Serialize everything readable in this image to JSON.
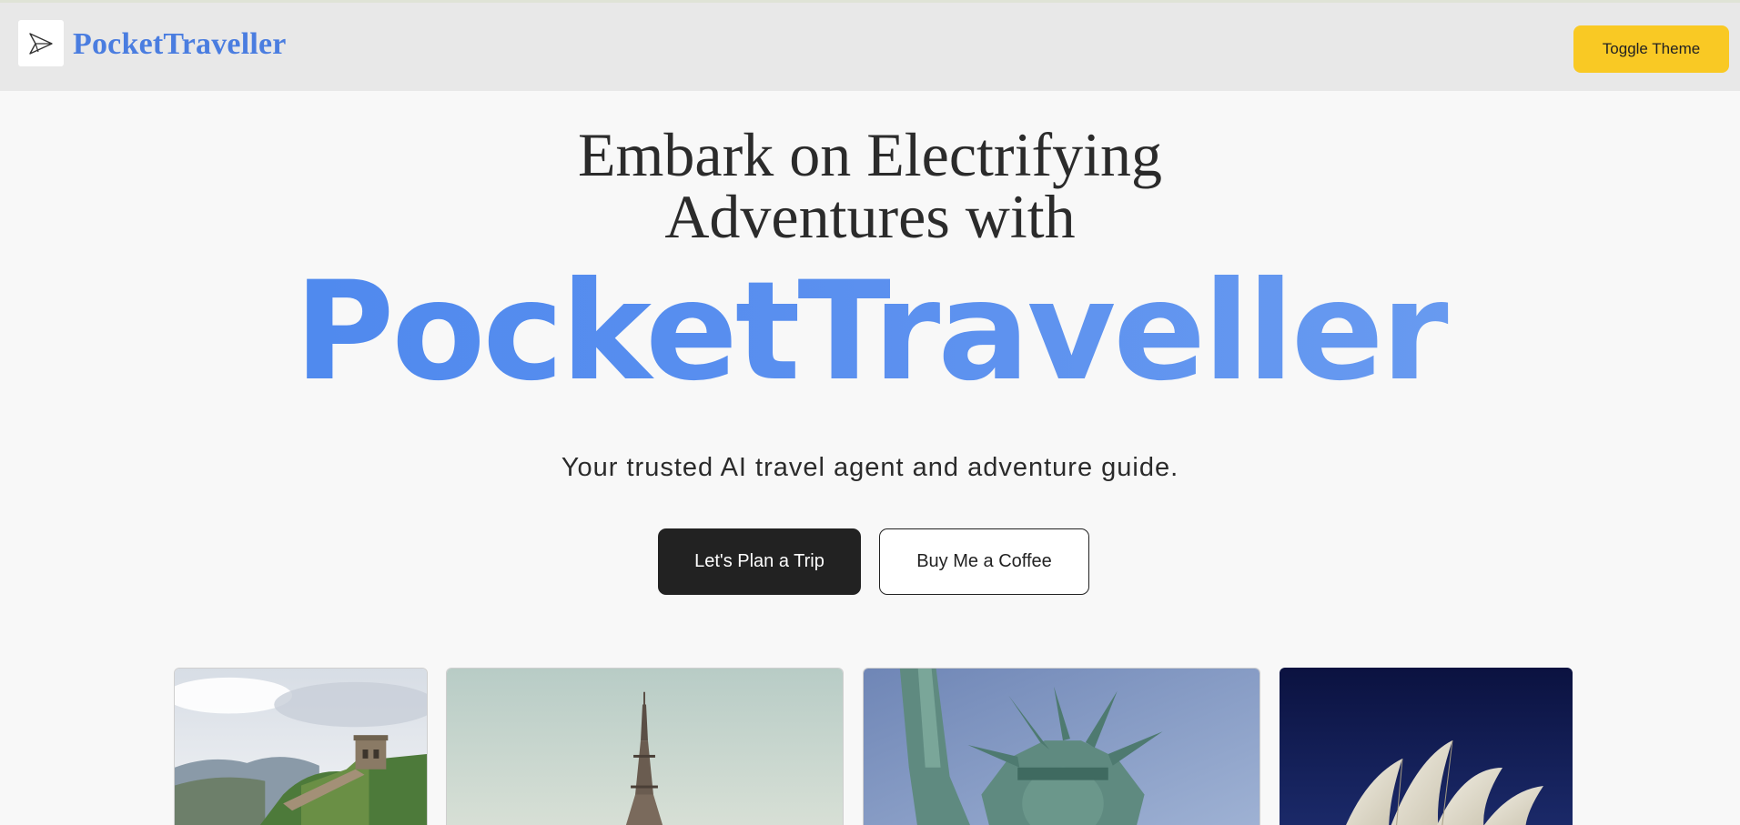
{
  "header": {
    "brand": "PocketTraveller",
    "logo_icon": "paper-plane-icon",
    "toggle_theme_label": "Toggle Theme"
  },
  "hero": {
    "line1": "Embark on Electrifying",
    "line2": "Adventures with",
    "brand": "PocketTraveller",
    "tagline": "Your trusted AI travel agent and adventure guide.",
    "primary_cta": "Let's Plan a Trip",
    "secondary_cta": "Buy Me a Coffee"
  },
  "colors": {
    "brand_blue": "#4a7de0",
    "toggle_yellow": "#f9c924",
    "primary_button": "#222222"
  },
  "gallery": [
    {
      "image": "great-wall-photo"
    },
    {
      "image": "eiffel-tower-photo"
    },
    {
      "image": "statue-of-liberty-photo"
    },
    {
      "image": "sydney-opera-house-photo"
    }
  ]
}
